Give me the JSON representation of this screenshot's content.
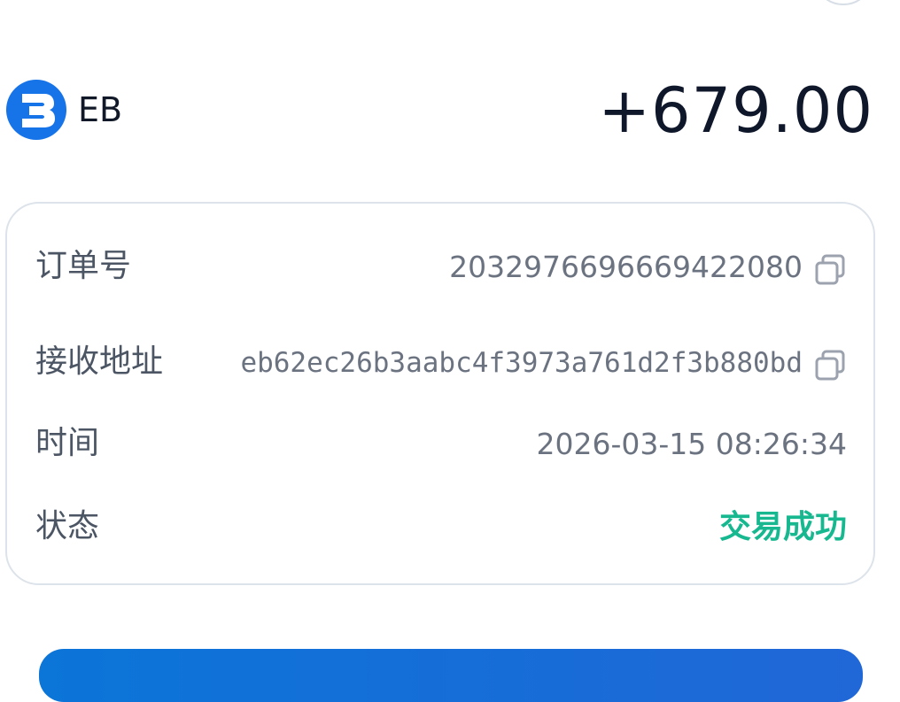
{
  "coin": {
    "symbol": "EB",
    "logo_icon": "eb-coin-icon"
  },
  "transaction": {
    "amount": "+679.00"
  },
  "details": {
    "order_label": "订单号",
    "order_value": "2032976696669422080",
    "address_label": "接收地址",
    "address_value": "eb62ec26b3aabc4f3973a761d2f3b880bd",
    "time_label": "时间",
    "time_value": "2026-03-15 08:26:34",
    "status_label": "状态",
    "status_value": "交易成功"
  },
  "icons": {
    "copy": "copy-icon",
    "top_button": "circle-button-icon"
  },
  "colors": {
    "brand_blue": "#1673e8",
    "success": "#17b890",
    "label_gray": "#4b5563",
    "value_gray": "#6b7280"
  }
}
